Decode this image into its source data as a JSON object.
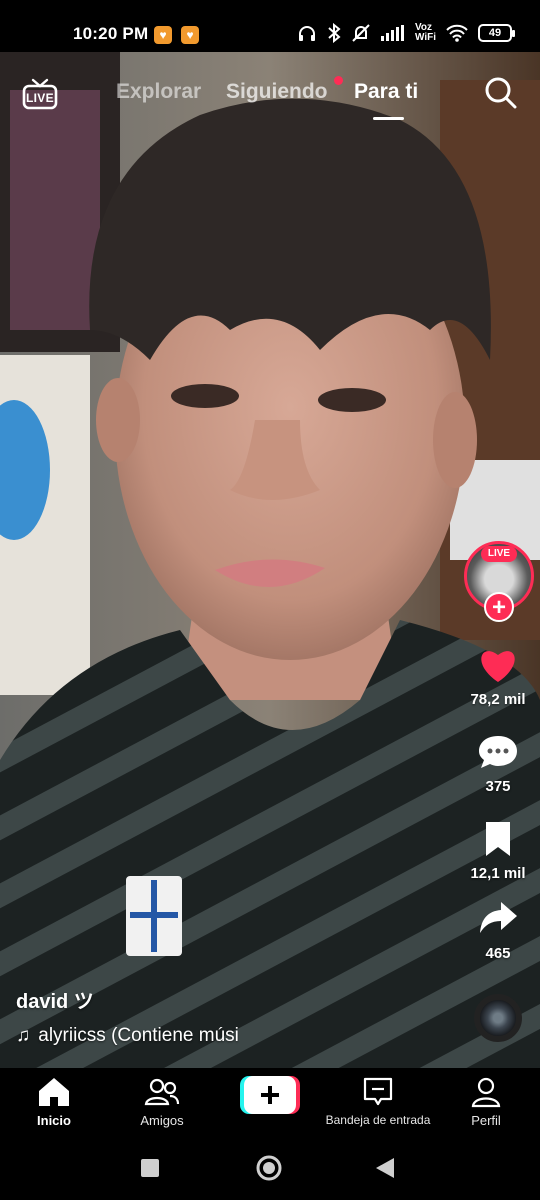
{
  "status_bar": {
    "time": "10:20 PM",
    "app_icon_1": "notification-app-icon",
    "app_icon_2": "notification-app-icon",
    "voz": "Voz",
    "wifi_label": "WiFi",
    "battery": "49"
  },
  "top_nav": {
    "live_label": "LIVE",
    "tabs": [
      {
        "label": "Explorar",
        "active": false
      },
      {
        "label": "Siguiendo",
        "active": false
      },
      {
        "label": "Para ti",
        "active": true
      }
    ]
  },
  "rail": {
    "avatar_live_badge": "LIVE",
    "likes": "78,2 mil",
    "comments": "375",
    "saves": "12,1 mil",
    "shares": "465"
  },
  "caption": {
    "username": "david ツ",
    "music": "alyriicss (Contiene músi"
  },
  "tab_bar": {
    "items": [
      {
        "label": "Inicio",
        "icon": "home-icon"
      },
      {
        "label": "Amigos",
        "icon": "friends-icon"
      },
      {
        "label": "",
        "icon": "create-icon"
      },
      {
        "label": "Bandeja de entrada",
        "icon": "inbox-icon"
      },
      {
        "label": "Perfil",
        "icon": "profile-icon"
      }
    ]
  },
  "colors": {
    "accent": "#fe2c55",
    "cyan": "#25f4ee"
  }
}
